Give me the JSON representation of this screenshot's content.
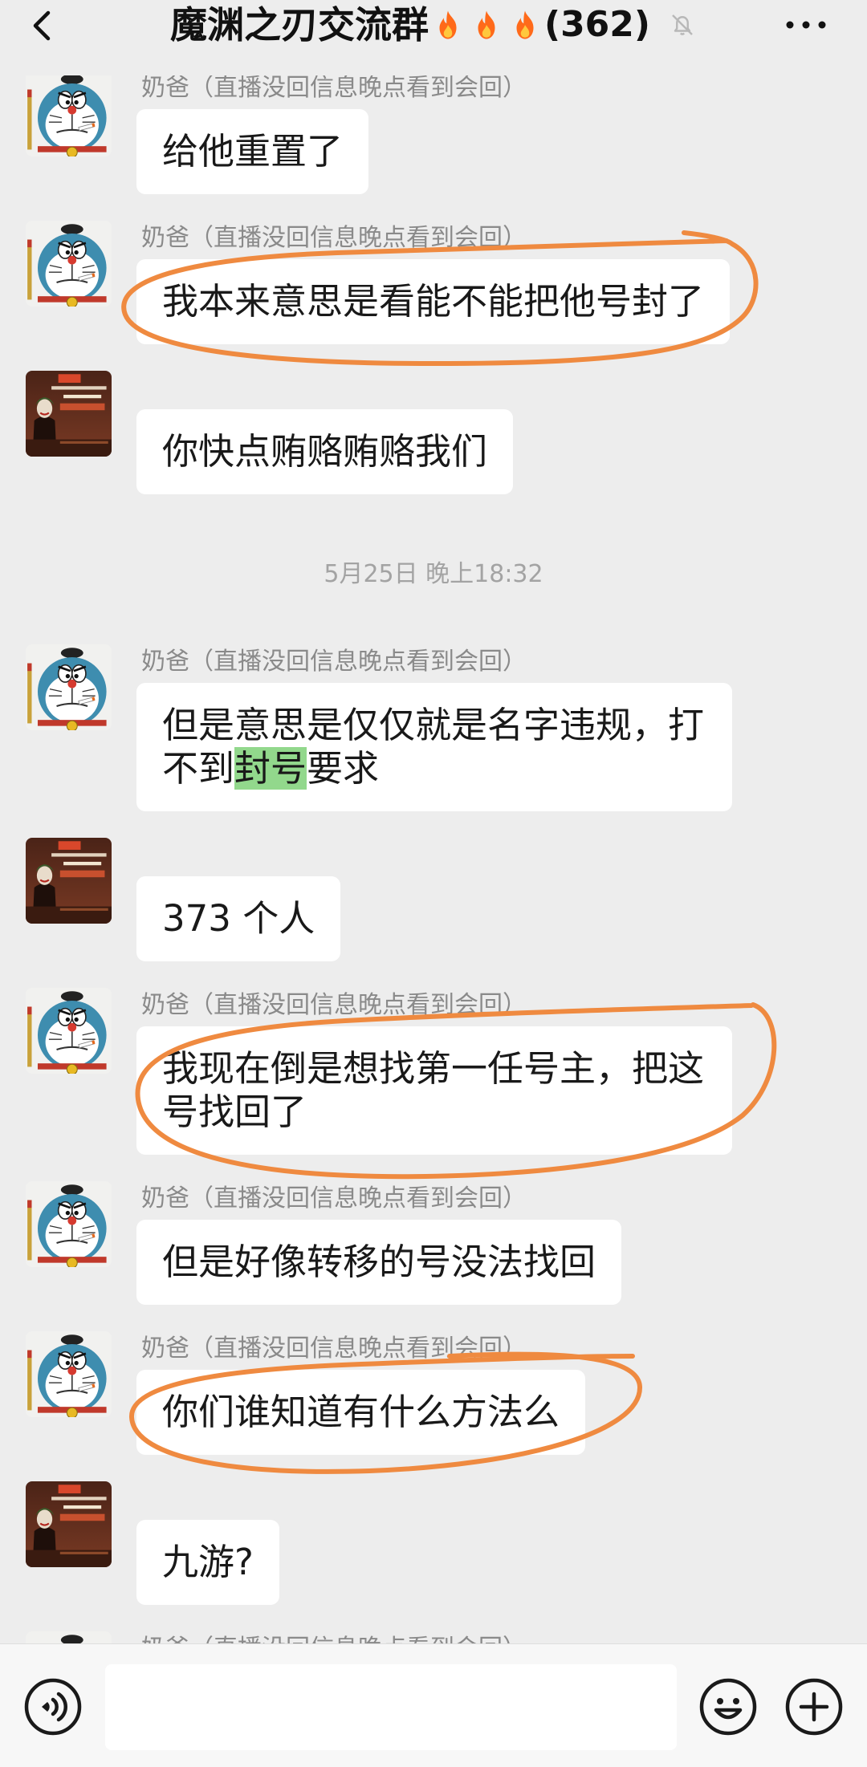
{
  "header": {
    "back_icon": "chevron-left-icon",
    "title": "魔渊之刃交流群",
    "title_icons": [
      "fire-icon",
      "fire-icon",
      "fire-icon"
    ],
    "member_count": "(362)",
    "mute_icon": "bell-off-icon",
    "more_icon": "more-dots-icon"
  },
  "chat": {
    "timestamp": "5月25日 晚上18:32",
    "messages": [
      {
        "avatar": "doraemon-avatar",
        "name": "奶爸（直播没回信息晚点看到会回）",
        "text": "给他重置了"
      },
      {
        "avatar": "doraemon-avatar",
        "name": "奶爸（直播没回信息晚点看到会回）",
        "text": "我本来意思是看能不能把他号封了"
      },
      {
        "avatar": "joker-avatar",
        "name": "",
        "text": "你快点贿赂贿赂我们"
      },
      {
        "avatar": "doraemon-avatar",
        "name": "奶爸（直播没回信息晚点看到会回）",
        "text_before": "但是意思是仅仅就是名字违规，打不到",
        "highlight": "封号",
        "text_after": "要求"
      },
      {
        "avatar": "joker-avatar",
        "name": "",
        "text": "373 个人"
      },
      {
        "avatar": "doraemon-avatar",
        "name": "奶爸（直播没回信息晚点看到会回）",
        "text": "我现在倒是想找第一任号主，把这号找回了"
      },
      {
        "avatar": "doraemon-avatar",
        "name": "奶爸（直播没回信息晚点看到会回）",
        "text": "但是好像转移的号没法找回"
      },
      {
        "avatar": "doraemon-avatar",
        "name": "奶爸（直播没回信息晚点看到会回）",
        "text": "你们谁知道有什么方法么"
      },
      {
        "avatar": "joker-avatar",
        "name": "",
        "text": "九游?"
      },
      {
        "avatar": "doraemon-avatar",
        "name": "奶爸（直播没回信息晚点看到会回）"
      }
    ]
  },
  "input_bar": {
    "voice_icon": "voice-icon",
    "value": "",
    "emoji_icon": "emoji-icon",
    "plus_icon": "plus-icon"
  },
  "colors": {
    "background": "#ededed",
    "bubble": "#ffffff",
    "name_text": "#8a8a8a",
    "annotation": "#ef8a40",
    "highlight": "#92d88c"
  }
}
